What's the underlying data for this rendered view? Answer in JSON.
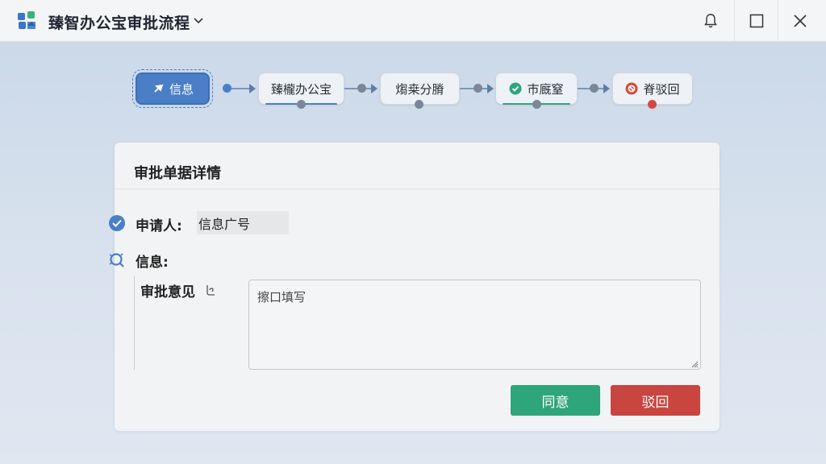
{
  "window": {
    "title": "臻智办公宝审批流程"
  },
  "flow": {
    "steps": [
      {
        "label": "信息",
        "state": "active",
        "icon": "pin-icon"
      },
      {
        "label": "臻櫳办公宝",
        "state": "pending",
        "icon": ""
      },
      {
        "label": "煼桒分膌",
        "state": "pending",
        "icon": ""
      },
      {
        "label": "巿廐窒",
        "state": "done",
        "icon": "check-circle-icon"
      },
      {
        "label": "脊驳回",
        "state": "rejected",
        "icon": "reject-circle-icon"
      }
    ]
  },
  "card": {
    "title": "审批单据详情",
    "applicant_label": "申请人:",
    "applicant_value": "信息广号",
    "info_label": "信息:",
    "opinion_label": "审批意见",
    "opinion_placeholder": "擦口填写",
    "approve_label": "同意",
    "reject_label": "驳回"
  },
  "colors": {
    "accent": "#4a7fc8",
    "approve": "#2ea57a",
    "reject": "#c9453f",
    "done": "#2ea57a"
  }
}
